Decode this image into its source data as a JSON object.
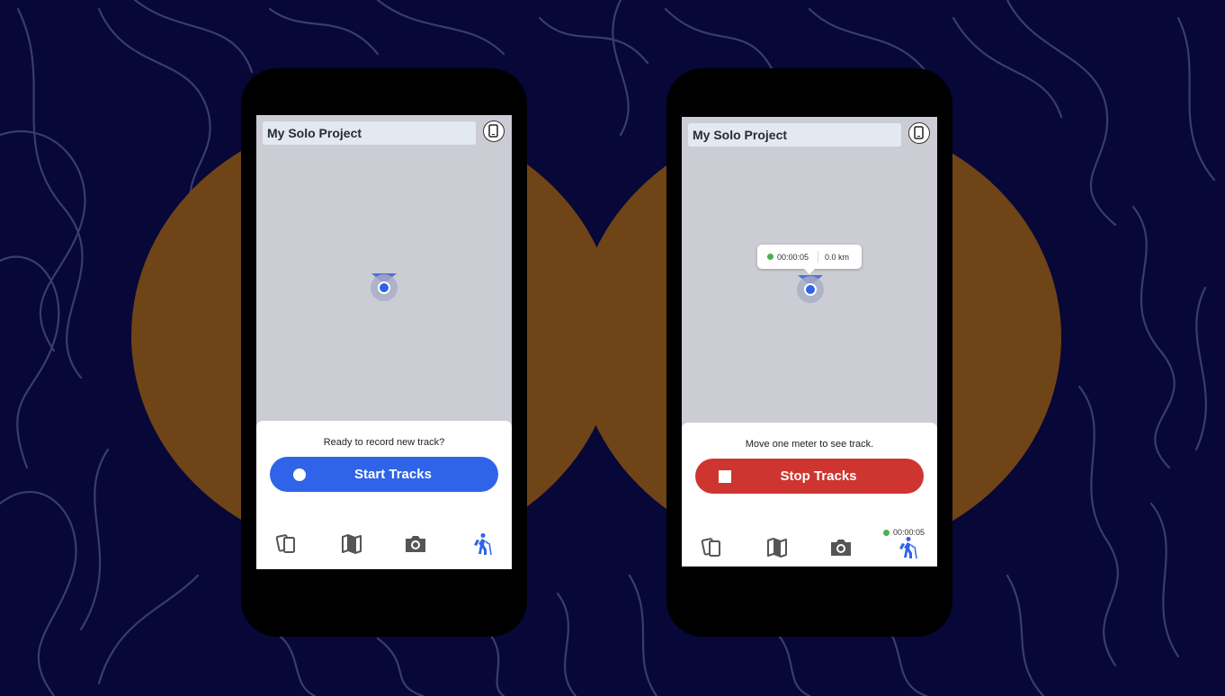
{
  "colors": {
    "background": "#070738",
    "blob": "#6f4417",
    "start_button": "#2f63e8",
    "stop_button": "#cf3530",
    "map": "#cbccd4",
    "active_nav": "#2f63e8",
    "inactive_nav": "#555555",
    "recording_dot": "#4caf50"
  },
  "left_phone": {
    "project_title": "My Solo Project",
    "prompt": "Ready to record new track?",
    "button_label": "Start Tracks",
    "nav": [
      {
        "icon": "cards-icon"
      },
      {
        "icon": "map-icon"
      },
      {
        "icon": "camera-icon"
      },
      {
        "icon": "hiking-icon",
        "active": true
      }
    ]
  },
  "right_phone": {
    "project_title": "My Solo Project",
    "bubble_time": "00:00:05",
    "bubble_distance": "0.0 km",
    "prompt": "Move one meter to see track.",
    "button_label": "Stop Tracks",
    "nav_timer": "00:00:05",
    "nav": [
      {
        "icon": "cards-icon"
      },
      {
        "icon": "map-icon"
      },
      {
        "icon": "camera-icon"
      },
      {
        "icon": "hiking-icon",
        "active": true
      }
    ]
  }
}
